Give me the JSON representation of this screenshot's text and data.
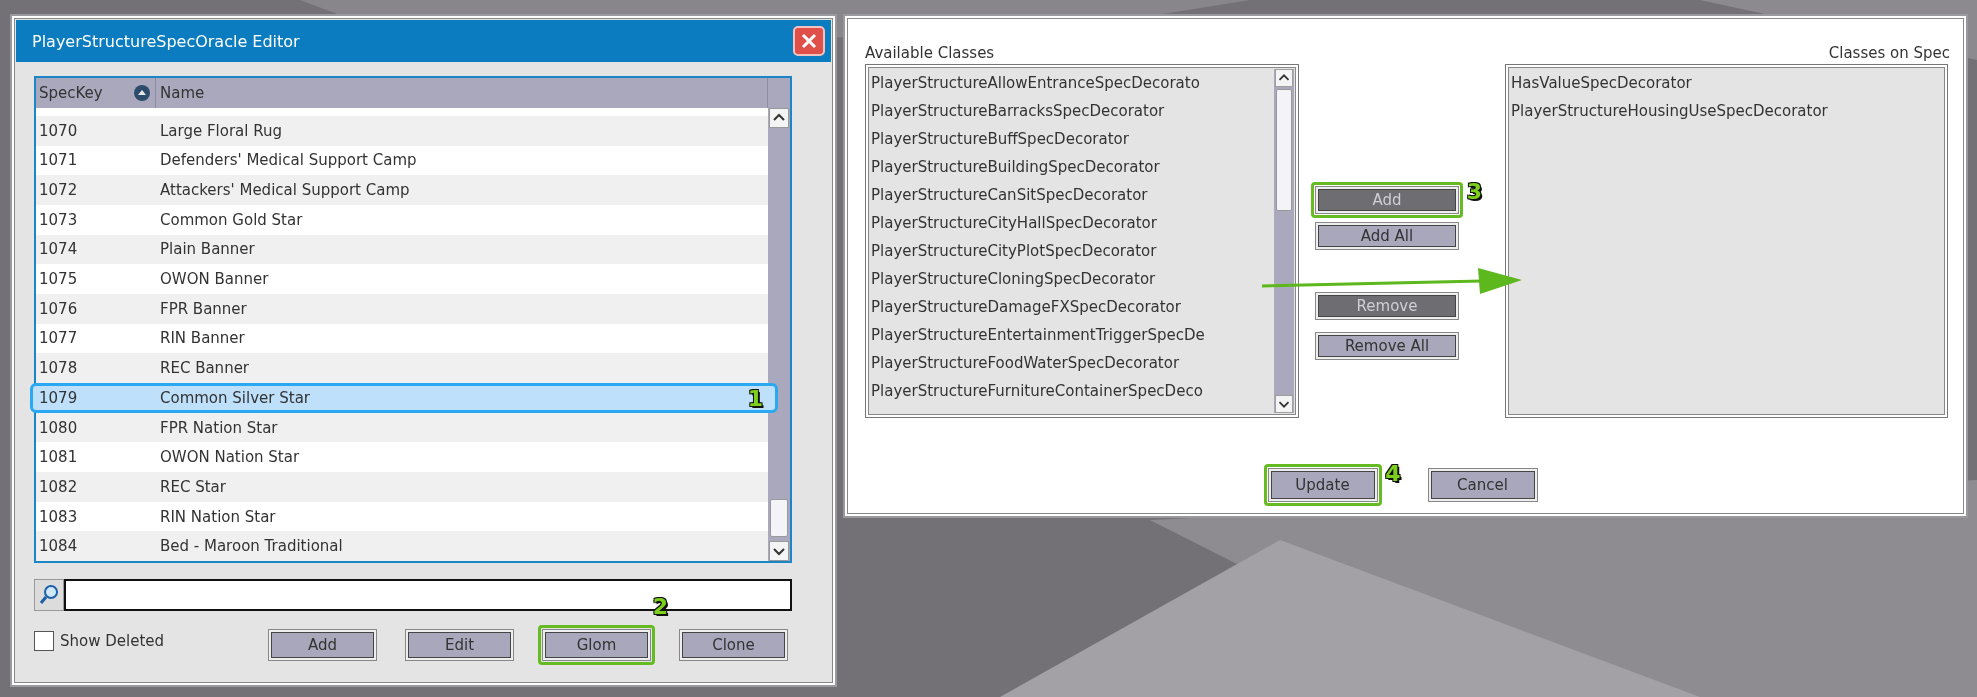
{
  "editor": {
    "title": "PlayerStructureSpecOracle Editor",
    "columns": [
      {
        "label": "SpecKey",
        "sorted": true
      },
      {
        "label": "Name",
        "sorted": false
      }
    ],
    "rows": [
      {
        "spec_key": "1070",
        "name": "Large Floral Rug",
        "selected": false
      },
      {
        "spec_key": "1071",
        "name": "Defenders' Medical Support Camp",
        "selected": false
      },
      {
        "spec_key": "1072",
        "name": "Attackers' Medical Support Camp",
        "selected": false
      },
      {
        "spec_key": "1073",
        "name": "Common Gold Star",
        "selected": false
      },
      {
        "spec_key": "1074",
        "name": "Plain Banner",
        "selected": false
      },
      {
        "spec_key": "1075",
        "name": "OWON Banner",
        "selected": false
      },
      {
        "spec_key": "1076",
        "name": "FPR Banner",
        "selected": false
      },
      {
        "spec_key": "1077",
        "name": "RIN Banner",
        "selected": false
      },
      {
        "spec_key": "1078",
        "name": "REC Banner",
        "selected": false
      },
      {
        "spec_key": "1079",
        "name": "Common Silver Star",
        "selected": true,
        "callout": "1"
      },
      {
        "spec_key": "1080",
        "name": "FPR Nation Star",
        "selected": false
      },
      {
        "spec_key": "1081",
        "name": "OWON Nation Star",
        "selected": false
      },
      {
        "spec_key": "1082",
        "name": "REC Star",
        "selected": false
      },
      {
        "spec_key": "1083",
        "name": "RIN Nation Star",
        "selected": false
      },
      {
        "spec_key": "1084",
        "name": "Bed - Maroon Traditional",
        "selected": false
      }
    ],
    "show_deleted": {
      "label": "Show Deleted",
      "checked": false
    },
    "buttons": [
      {
        "label": "Add"
      },
      {
        "label": "Edit"
      },
      {
        "label": "Glom",
        "callout": "2"
      },
      {
        "label": "Clone"
      }
    ]
  },
  "classes_dialog": {
    "available_label": "Available Classes",
    "assigned_label": "Classes on Spec",
    "available": [
      "PlayerStructureAllowEntranceSpecDecorato",
      "PlayerStructureBarracksSpecDecorator",
      "PlayerStructureBuffSpecDecorator",
      "PlayerStructureBuildingSpecDecorator",
      "PlayerStructureCanSitSpecDecorator",
      "PlayerStructureCityHallSpecDecorator",
      "PlayerStructureCityPlotSpecDecorator",
      "PlayerStructureCloningSpecDecorator",
      "PlayerStructureDamageFXSpecDecorator",
      "PlayerStructureEntertainmentTriggerSpecDe",
      "PlayerStructureFoodWaterSpecDecorator",
      "PlayerStructureFurnitureContainerSpecDeco"
    ],
    "assigned": [
      "HasValueSpecDecorator",
      "PlayerStructureHousingUseSpecDecorator"
    ],
    "buttons": [
      {
        "label": "Add",
        "disabled": true,
        "callout": "3"
      },
      {
        "label": "Add All",
        "disabled": false
      },
      {
        "label": "Remove",
        "disabled": true
      },
      {
        "label": "Remove All",
        "disabled": false
      }
    ],
    "footer_buttons": [
      {
        "label": "Update",
        "callout": "4"
      },
      {
        "label": "Cancel"
      }
    ]
  }
}
